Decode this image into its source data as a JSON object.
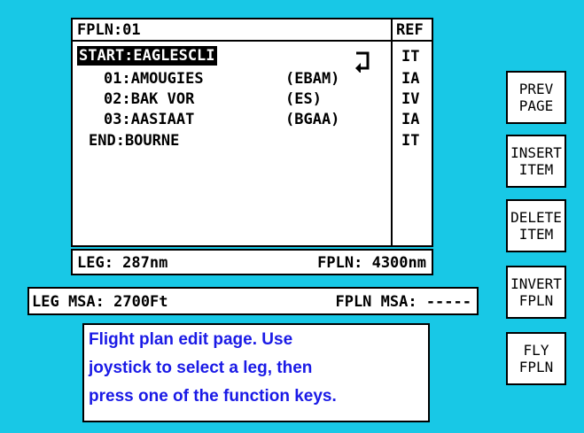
{
  "fpln": {
    "title": "FPLN:01",
    "ref_header": "REF",
    "start": "START:EAGLESCLI",
    "waypoints": [
      {
        "label": "01:AMOUGIES",
        "code": "(EBAM)",
        "ref": "IA"
      },
      {
        "label": "02:BAK VOR",
        "code": "(ES)",
        "ref": "IV"
      },
      {
        "label": "03:AASIAAT",
        "code": "(BGAA)",
        "ref": "IA"
      }
    ],
    "start_ref": "IT",
    "end": "END:BOURNE",
    "end_ref": "IT",
    "icons": {
      "return": "return-arrow-icon"
    }
  },
  "leg_bar": {
    "leg": "LEG: 287nm",
    "fpln_total": "FPLN: 4300nm"
  },
  "msa_bar": {
    "leg_msa": "LEG MSA: 2700Ft",
    "fpln_msa": "FPLN MSA: -----"
  },
  "help": {
    "line1": "Flight plan edit page. Use",
    "line2": "joystick to select a leg, then",
    "line3": "press one of the function keys."
  },
  "keys": {
    "prev": [
      "PREV",
      "PAGE"
    ],
    "insert": [
      "INSERT",
      "ITEM"
    ],
    "delete": [
      "DELETE",
      "ITEM"
    ],
    "invert": [
      "INVERT",
      "FPLN"
    ],
    "fly": [
      "FLY",
      "FPLN"
    ]
  },
  "colors": {
    "background": "#18c8e6",
    "help_text": "#1a1ae6",
    "panel": "#ffffff",
    "border": "#000000"
  }
}
